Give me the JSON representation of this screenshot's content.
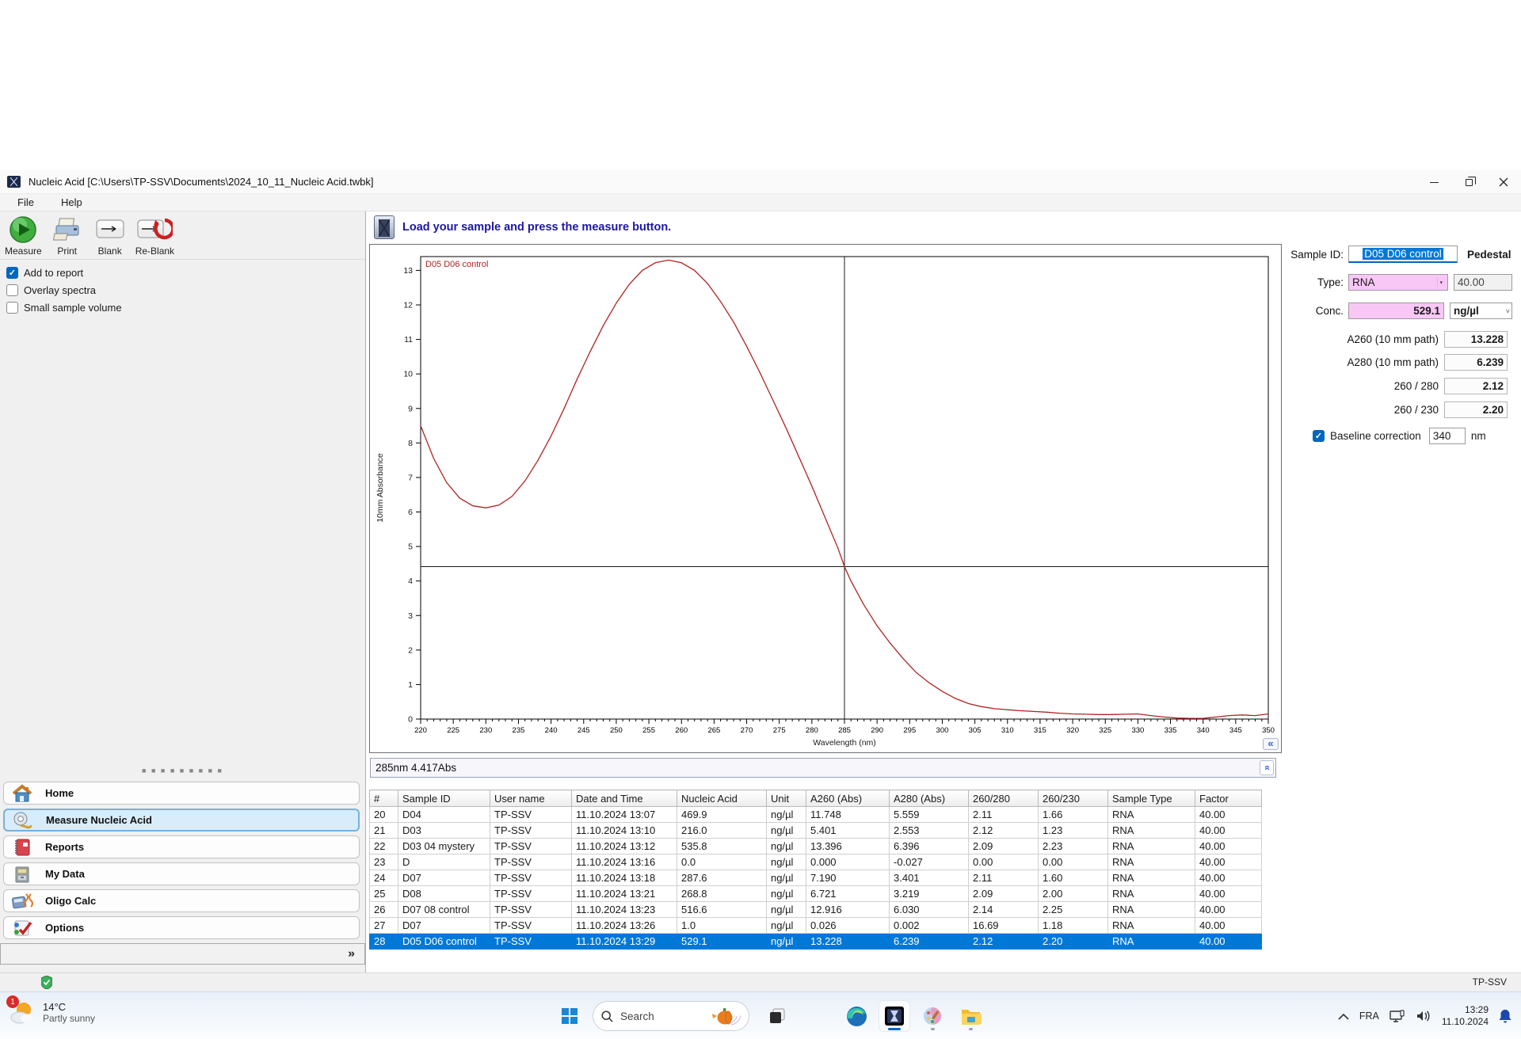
{
  "window": {
    "title": "Nucleic Acid  [C:\\Users\\TP-SSV\\Documents\\2024_10_11_Nucleic Acid.twbk]",
    "menu_items": [
      "File",
      "Help"
    ]
  },
  "toolbar": {
    "measure": "Measure",
    "print": "Print",
    "blank": "Blank",
    "reblank": "Re-Blank"
  },
  "options": {
    "add_to_report": {
      "label": "Add to report",
      "checked": true
    },
    "overlay_spectra": {
      "label": "Overlay spectra",
      "checked": false
    },
    "small_sample_volume": {
      "label": "Small sample volume",
      "checked": false
    }
  },
  "sidebar": {
    "items": [
      {
        "label": "Home",
        "selected": false
      },
      {
        "label": "Measure Nucleic Acid",
        "selected": true
      },
      {
        "label": "Reports",
        "selected": false
      },
      {
        "label": "My Data",
        "selected": false
      },
      {
        "label": "Oligo Calc",
        "selected": false
      },
      {
        "label": "Options",
        "selected": false
      }
    ],
    "collapse_glyph": "»"
  },
  "header": {
    "message": "Load your sample and press the measure button."
  },
  "sample_panel": {
    "sample_id_label": "Sample ID:",
    "sample_id_value": "D05 D06 control",
    "mode_label": "Pedestal",
    "type_label": "Type:",
    "type_value": "RNA",
    "factor_value": "40.00",
    "conc_label": "Conc.",
    "conc_value": "529.1",
    "conc_unit": "ng/µl",
    "a260_label": "A260 (10 mm path)",
    "a260_value": "13.228",
    "a280_label": "A280 (10 mm path)",
    "a280_value": "6.239",
    "ratio_260_280_label": "260 / 280",
    "ratio_260_280_value": "2.12",
    "ratio_260_230_label": "260 / 230",
    "ratio_260_230_value": "2.20",
    "baseline_label": "Baseline correction",
    "baseline_checked": true,
    "baseline_value": "340",
    "baseline_unit": "nm",
    "dropdown_glyph": "▼"
  },
  "chart_data": {
    "type": "line",
    "title": "",
    "xlabel": "Wavelength (nm)",
    "ylabel": "10mm Absorbance",
    "xlim": [
      220,
      350
    ],
    "ylim": [
      0,
      13.4
    ],
    "x_tick_step": 5,
    "y_tick_step": 1,
    "grid": false,
    "legend_position": "top-left-inline-label",
    "cursor": {
      "wavelength": 285,
      "absorbance": 4.417
    },
    "series": [
      {
        "name": "D05 D06 control",
        "color": "#b22222",
        "points": [
          [
            220,
            8.5
          ],
          [
            222,
            7.55
          ],
          [
            224,
            6.85
          ],
          [
            226,
            6.4
          ],
          [
            228,
            6.18
          ],
          [
            230,
            6.12
          ],
          [
            232,
            6.2
          ],
          [
            234,
            6.45
          ],
          [
            236,
            6.9
          ],
          [
            238,
            7.5
          ],
          [
            240,
            8.2
          ],
          [
            242,
            9.0
          ],
          [
            244,
            9.85
          ],
          [
            246,
            10.65
          ],
          [
            248,
            11.4
          ],
          [
            250,
            12.05
          ],
          [
            252,
            12.6
          ],
          [
            254,
            13.0
          ],
          [
            256,
            13.22
          ],
          [
            258,
            13.3
          ],
          [
            260,
            13.22
          ],
          [
            262,
            13.0
          ],
          [
            264,
            12.62
          ],
          [
            266,
            12.1
          ],
          [
            268,
            11.5
          ],
          [
            270,
            10.8
          ],
          [
            272,
            10.05
          ],
          [
            274,
            9.25
          ],
          [
            276,
            8.45
          ],
          [
            278,
            7.6
          ],
          [
            280,
            6.75
          ],
          [
            282,
            5.85
          ],
          [
            284,
            4.95
          ],
          [
            285,
            4.417
          ],
          [
            286,
            4.0
          ],
          [
            288,
            3.3
          ],
          [
            290,
            2.7
          ],
          [
            292,
            2.2
          ],
          [
            294,
            1.75
          ],
          [
            296,
            1.35
          ],
          [
            298,
            1.05
          ],
          [
            300,
            0.8
          ],
          [
            302,
            0.6
          ],
          [
            304,
            0.45
          ],
          [
            306,
            0.36
          ],
          [
            308,
            0.3
          ],
          [
            310,
            0.27
          ],
          [
            312,
            0.24
          ],
          [
            314,
            0.22
          ],
          [
            316,
            0.2
          ],
          [
            318,
            0.17
          ],
          [
            320,
            0.15
          ],
          [
            322,
            0.14
          ],
          [
            324,
            0.13
          ],
          [
            326,
            0.13
          ],
          [
            328,
            0.14
          ],
          [
            330,
            0.15
          ],
          [
            332,
            0.1
          ],
          [
            334,
            0.06
          ],
          [
            336,
            0.03
          ],
          [
            338,
            0.02
          ],
          [
            340,
            0.02
          ],
          [
            342,
            0.06
          ],
          [
            344,
            0.1
          ],
          [
            346,
            0.12
          ],
          [
            348,
            0.1
          ],
          [
            350,
            0.15
          ]
        ]
      }
    ],
    "collapse_glyph": "«"
  },
  "status_line": {
    "text": "285nm 4.417Abs",
    "expand_glyph": "»"
  },
  "results_table": {
    "columns": [
      "#",
      "Sample ID",
      "User name",
      "Date and Time",
      "Nucleic Acid",
      "Unit",
      "A260 (Abs)",
      "A280 (Abs)",
      "260/280",
      "260/230",
      "Sample Type",
      "Factor"
    ],
    "rows": [
      {
        "selected": false,
        "cells": [
          "20",
          "D04",
          "TP-SSV",
          "11.10.2024 13:07",
          "469.9",
          "ng/µl",
          "11.748",
          "5.559",
          "2.11",
          "1.66",
          "RNA",
          "40.00"
        ]
      },
      {
        "selected": false,
        "cells": [
          "21",
          "D03",
          "TP-SSV",
          "11.10.2024 13:10",
          "216.0",
          "ng/µl",
          "5.401",
          "2.553",
          "2.12",
          "1.23",
          "RNA",
          "40.00"
        ]
      },
      {
        "selected": false,
        "cells": [
          "22",
          "D03 04 mystery",
          "TP-SSV",
          "11.10.2024 13:12",
          "535.8",
          "ng/µl",
          "13.396",
          "6.396",
          "2.09",
          "2.23",
          "RNA",
          "40.00"
        ]
      },
      {
        "selected": false,
        "cells": [
          "23",
          "D",
          "TP-SSV",
          "11.10.2024 13:16",
          "0.0",
          "ng/µl",
          "0.000",
          "-0.027",
          "0.00",
          "0.00",
          "RNA",
          "40.00"
        ]
      },
      {
        "selected": false,
        "cells": [
          "24",
          "D07",
          "TP-SSV",
          "11.10.2024 13:18",
          "287.6",
          "ng/µl",
          "7.190",
          "3.401",
          "2.11",
          "1.60",
          "RNA",
          "40.00"
        ]
      },
      {
        "selected": false,
        "cells": [
          "25",
          "D08",
          "TP-SSV",
          "11.10.2024 13:21",
          "268.8",
          "ng/µl",
          "6.721",
          "3.219",
          "2.09",
          "2.00",
          "RNA",
          "40.00"
        ]
      },
      {
        "selected": false,
        "cells": [
          "26",
          "D07 08 control",
          "TP-SSV",
          "11.10.2024 13:23",
          "516.6",
          "ng/µl",
          "12.916",
          "6.030",
          "2.14",
          "2.25",
          "RNA",
          "40.00"
        ]
      },
      {
        "selected": false,
        "cells": [
          "27",
          "D07",
          "TP-SSV",
          "11.10.2024 13:26",
          "1.0",
          "ng/µl",
          "0.026",
          "0.002",
          "16.69",
          "1.18",
          "RNA",
          "40.00"
        ]
      },
      {
        "selected": true,
        "cells": [
          "28",
          "D05 D06 control",
          "TP-SSV",
          "11.10.2024 13:29",
          "529.1",
          "ng/µl",
          "13.228",
          "6.239",
          "2.12",
          "2.20",
          "RNA",
          "40.00"
        ]
      }
    ]
  },
  "app_status": {
    "user": "TP-SSV"
  },
  "taskbar": {
    "weather": {
      "temp": "14°C",
      "condition": "Partly sunny",
      "badge": "1"
    },
    "search_placeholder": "Search",
    "tray": {
      "language": "FRA",
      "time": "13:29",
      "date": "11.10.2024"
    }
  },
  "colors": {
    "selection_blue": "#0078d7",
    "accent_blue": "#0067c0",
    "pink_field": "#f8c7f6",
    "curve_red": "#b22222",
    "header_text_blue": "#1c16a5"
  }
}
